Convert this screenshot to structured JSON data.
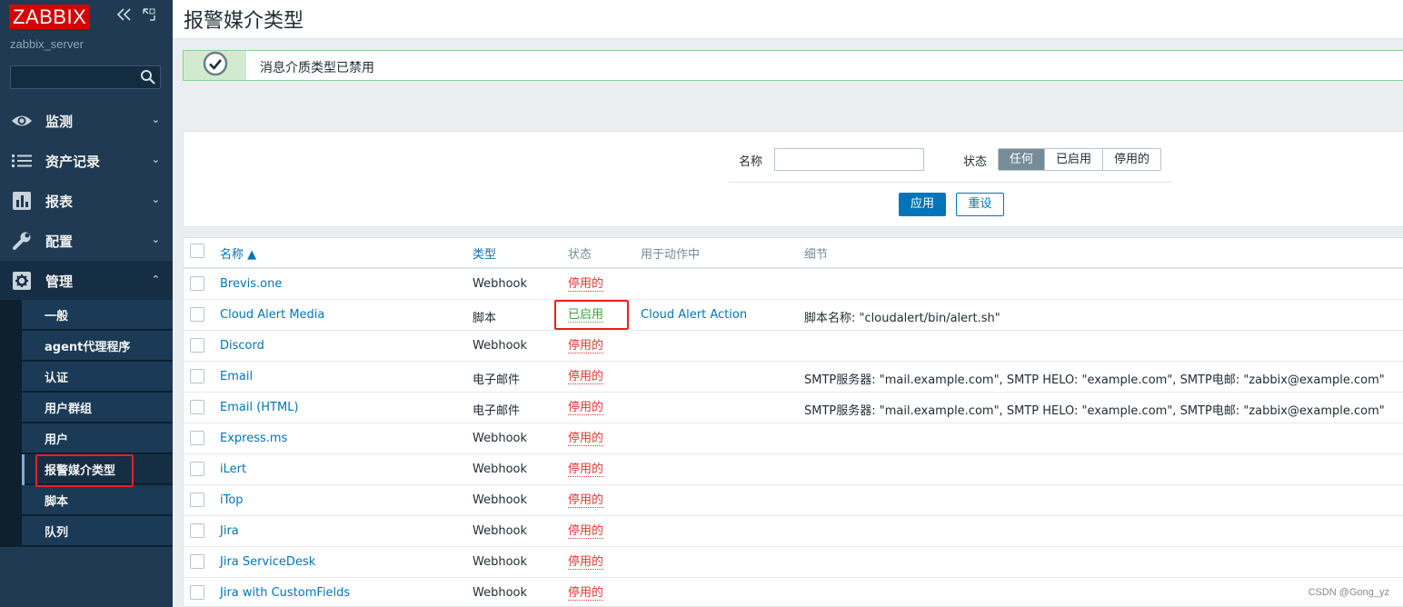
{
  "app": {
    "logo": "ZABBIX",
    "server": "zabbix_server"
  },
  "sidebar": {
    "menu": [
      {
        "label": "监测",
        "icon": "eye-icon"
      },
      {
        "label": "资产记录",
        "icon": "list-icon"
      },
      {
        "label": "报表",
        "icon": "bar-chart-icon"
      },
      {
        "label": "配置",
        "icon": "wrench-icon"
      },
      {
        "label": "管理",
        "icon": "gear-icon"
      }
    ],
    "submenu": [
      "一般",
      "agent代理程序",
      "认证",
      "用户群组",
      "用户",
      "报警媒介类型",
      "脚本",
      "队列"
    ],
    "selected_submenu": "报警媒介类型"
  },
  "page": {
    "title": "报警媒介类型"
  },
  "message": {
    "text": "消息介质类型已禁用"
  },
  "filter": {
    "name_label": "名称",
    "name_value": "",
    "status_label": "状态",
    "status_options": [
      "任何",
      "已启用",
      "停用的"
    ],
    "status_selected": "任何",
    "apply": "应用",
    "reset": "重设"
  },
  "table": {
    "headers": {
      "name": "名称 ▲",
      "type": "类型",
      "status": "状态",
      "used_in": "用于动作中",
      "details": "细节"
    },
    "rows": [
      {
        "name": "Brevis.one",
        "type": "Webhook",
        "status": "停用的",
        "action": "",
        "details": ""
      },
      {
        "name": "Cloud Alert Media",
        "type": "脚本",
        "status": "已启用",
        "action": "Cloud Alert Action",
        "details": "脚本名称: \"cloudalert/bin/alert.sh\""
      },
      {
        "name": "Discord",
        "type": "Webhook",
        "status": "停用的",
        "action": "",
        "details": ""
      },
      {
        "name": "Email",
        "type": "电子邮件",
        "status": "停用的",
        "action": "",
        "details": "SMTP服务器: \"mail.example.com\", SMTP HELO: \"example.com\", SMTP电邮: \"zabbix@example.com\""
      },
      {
        "name": "Email (HTML)",
        "type": "电子邮件",
        "status": "停用的",
        "action": "",
        "details": "SMTP服务器: \"mail.example.com\", SMTP HELO: \"example.com\", SMTP电邮: \"zabbix@example.com\""
      },
      {
        "name": "Express.ms",
        "type": "Webhook",
        "status": "停用的",
        "action": "",
        "details": ""
      },
      {
        "name": "iLert",
        "type": "Webhook",
        "status": "停用的",
        "action": "",
        "details": ""
      },
      {
        "name": "iTop",
        "type": "Webhook",
        "status": "停用的",
        "action": "",
        "details": ""
      },
      {
        "name": "Jira",
        "type": "Webhook",
        "status": "停用的",
        "action": "",
        "details": ""
      },
      {
        "name": "Jira ServiceDesk",
        "type": "Webhook",
        "status": "停用的",
        "action": "",
        "details": ""
      },
      {
        "name": "Jira with CustomFields",
        "type": "Webhook",
        "status": "停用的",
        "action": "",
        "details": ""
      }
    ]
  },
  "watermark": "CSDN @Gong_yz",
  "colors": {
    "accent": "#0275b8",
    "sidebar": "#1f3a52",
    "disabled": "#e33734",
    "enabled": "#429e47",
    "logo": "#d40000"
  }
}
